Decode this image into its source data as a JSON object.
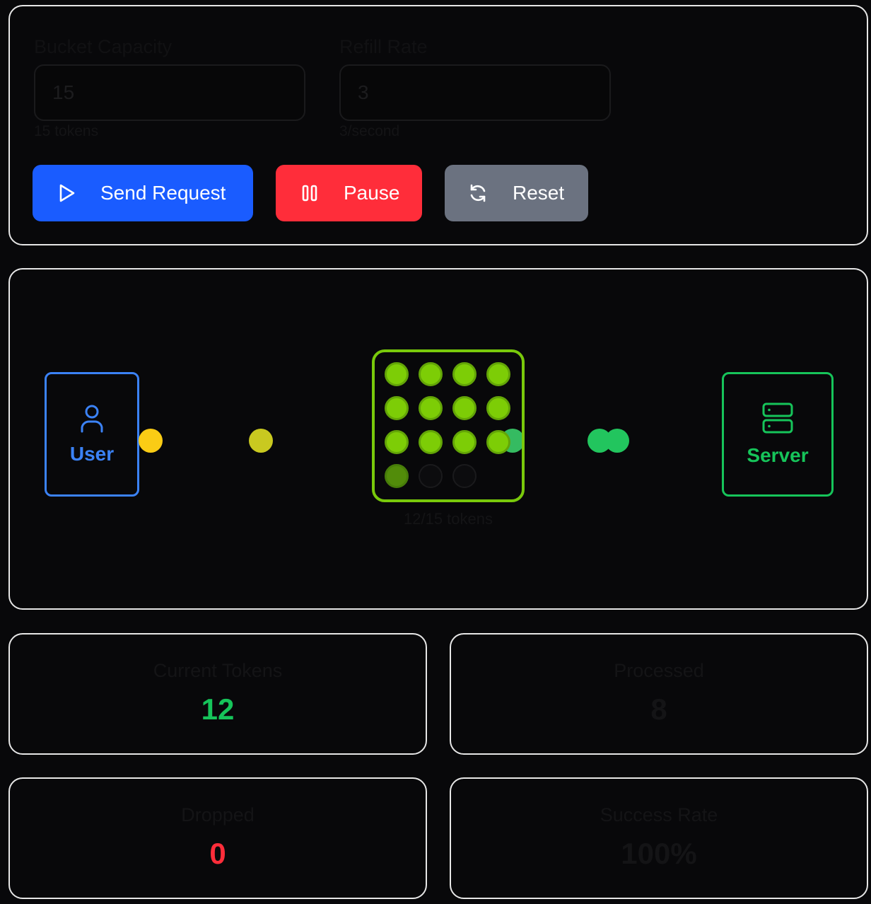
{
  "controls": {
    "bucket_capacity": {
      "label": "Bucket Capacity",
      "value": "15",
      "hint": "15 tokens"
    },
    "refill_rate": {
      "label": "Refill Rate",
      "value": "3",
      "hint": "3/second"
    },
    "buttons": {
      "send": {
        "label": "Send Request",
        "icon": "play-icon",
        "color": "#1a5cff"
      },
      "pause": {
        "label": "Pause",
        "icon": "pause-icon",
        "color": "#ff2d3a"
      },
      "reset": {
        "label": "Reset",
        "icon": "refresh-icon",
        "color": "#6b7280"
      }
    }
  },
  "simulation": {
    "user": {
      "label": "User",
      "icon": "user-icon",
      "color": "#3b82f6"
    },
    "server": {
      "label": "Server",
      "icon": "server-icon",
      "color": "#16c45a"
    },
    "bucket": {
      "caption": "12/15 tokens",
      "tokens_current": 12,
      "tokens_capacity": 15,
      "color": "#79c90b"
    }
  },
  "stats": {
    "current_tokens": {
      "title": "Current Tokens",
      "value": "12",
      "color": "#16c45a"
    },
    "processed": {
      "title": "Processed",
      "value": "8",
      "color": "#141416"
    },
    "dropped": {
      "title": "Dropped",
      "value": "0",
      "color": "#ff2d3a"
    },
    "success_rate": {
      "title": "Success Rate",
      "value": "100%",
      "color": "#141416"
    }
  }
}
